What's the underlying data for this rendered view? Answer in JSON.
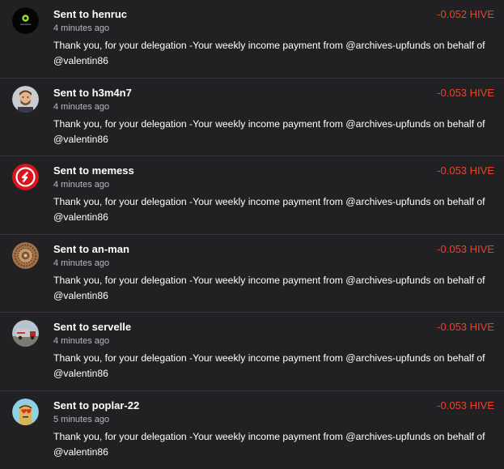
{
  "colors": {
    "background": "#212124",
    "divider": "#35353a",
    "amount_negative": "#e8442b",
    "text_primary": "#ffffff",
    "text_secondary": "#b9b9be"
  },
  "transactions": [
    {
      "title": "Sent to henruc",
      "time": "4 minutes ago",
      "amount": "-0.052 HIVE",
      "memo": "Thank you, for your delegation -Your weekly income payment from @archives-upfunds on behalf of @valentin86",
      "avatar_icon": "green-round-logo-icon"
    },
    {
      "title": "Sent to h3m4n7",
      "time": "4 minutes ago",
      "amount": "-0.053 HIVE",
      "memo": "Thank you, for your delegation -Your weekly income payment from @archives-upfunds on behalf of @valentin86",
      "avatar_icon": "person-photo-icon"
    },
    {
      "title": "Sent to memess",
      "time": "4 minutes ago",
      "amount": "-0.053 HIVE",
      "memo": "Thank you, for your delegation -Your weekly income payment from @archives-upfunds on behalf of @valentin86",
      "avatar_icon": "red-badge-logo-icon"
    },
    {
      "title": "Sent to an-man",
      "time": "4 minutes ago",
      "amount": "-0.053 HIVE",
      "memo": "Thank you, for your delegation -Your weekly income payment from @archives-upfunds on behalf of @valentin86",
      "avatar_icon": "mandala-pattern-icon"
    },
    {
      "title": "Sent to servelle",
      "time": "4 minutes ago",
      "amount": "-0.053 HIVE",
      "memo": "Thank you, for your delegation -Your weekly income payment from @archives-upfunds on behalf of @valentin86",
      "avatar_icon": "truck-photo-icon"
    },
    {
      "title": "Sent to poplar-22",
      "time": "5 minutes ago",
      "amount": "-0.053 HIVE",
      "memo": "Thank you, for your delegation -Your weekly income payment from @archives-upfunds on behalf of @valentin86",
      "avatar_icon": "cartoon-heart-eyes-icon"
    }
  ]
}
